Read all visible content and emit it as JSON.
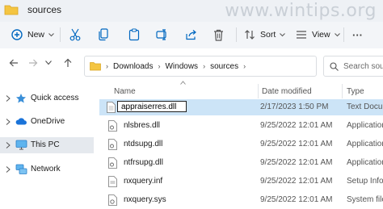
{
  "window": {
    "title": "sources",
    "watermark": "www.wintips.org"
  },
  "toolbar": {
    "new_label": "New",
    "sort_label": "Sort",
    "view_label": "View",
    "more_label": "···"
  },
  "address": {
    "crumbs": [
      "Downloads",
      "Windows",
      "sources"
    ],
    "search_placeholder": "Search sour"
  },
  "navigation": {
    "items": [
      {
        "label": "Quick access",
        "icon": "star-icon"
      },
      {
        "label": "OneDrive",
        "icon": "cloud-icon"
      },
      {
        "label": "This PC",
        "icon": "computer-icon",
        "selected": true
      },
      {
        "label": "Network",
        "icon": "network-icon"
      }
    ]
  },
  "columns": {
    "name": "Name",
    "date": "Date modified",
    "type": "Type"
  },
  "files": [
    {
      "name": "appraiserres.dll",
      "date": "2/17/2023 1:50 PM",
      "type": "Text Docum",
      "selected": true,
      "renaming": true
    },
    {
      "name": "nlsbres.dll",
      "date": "9/25/2022 12:01 AM",
      "type": "Application"
    },
    {
      "name": "ntdsupg.dll",
      "date": "9/25/2022 12:01 AM",
      "type": "Application"
    },
    {
      "name": "ntfrsupg.dll",
      "date": "9/25/2022 12:01 AM",
      "type": "Application"
    },
    {
      "name": "nxquery.inf",
      "date": "9/25/2022 12:01 AM",
      "type": "Setup Infor"
    },
    {
      "name": "nxquery.sys",
      "date": "9/25/2022 12:01 AM",
      "type": "System file"
    }
  ],
  "colors": {
    "accent": "#0067c0",
    "selected_row": "#cce4f7",
    "folder": "#f4c542"
  }
}
